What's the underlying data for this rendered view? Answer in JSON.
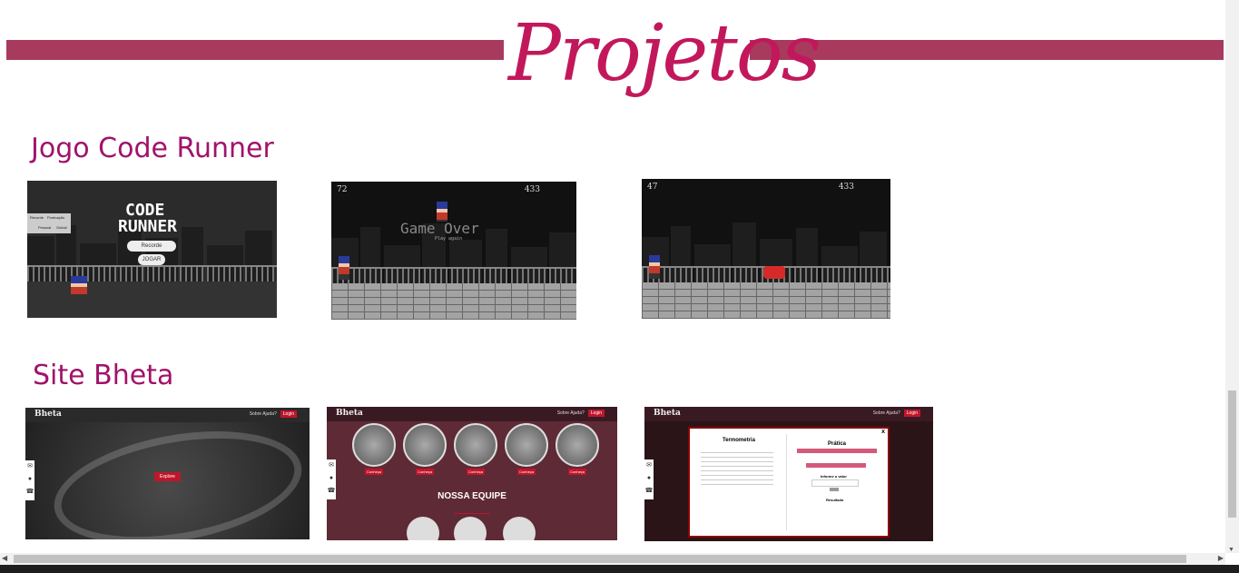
{
  "header": {
    "title": "Projetos",
    "accent_color": "#a73a5d",
    "title_color": "#c2185b"
  },
  "sections": [
    {
      "title": "Jogo Code Runner",
      "thumbs": [
        {
          "logo_line1": "CODE",
          "logo_line2": "RUNNER",
          "menu_left": "Recorde",
          "menu_right": "Pontuação",
          "tab_left": "Pessoal",
          "tab_right": "Global",
          "button1": "Recorde",
          "button2": "JOGAR"
        },
        {
          "score_left": "72",
          "score_right": "433",
          "overlay": "Game Over",
          "overlay_sub": "Play again"
        },
        {
          "score_left": "47",
          "score_right": "433"
        }
      ]
    },
    {
      "title": "Site Bheta",
      "thumbs": [
        {
          "brand": "Bheta",
          "nav_link1": "Sobre",
          "nav_link2": "Ajuda?",
          "nav_login": "Login",
          "cta": "Explore"
        },
        {
          "brand": "Bheta",
          "nav_link1": "Sobre",
          "nav_link2": "Ajuda?",
          "nav_login": "Login",
          "heading": "NOSSA EQUIPE",
          "chip": "Conheça"
        },
        {
          "brand": "Bheta",
          "nav_link1": "Sobre",
          "nav_link2": "Ajuda?",
          "nav_login": "Login",
          "modal_left_title": "Termometria",
          "modal_right_title": "Prática",
          "modal_input_label": "Informe o valor",
          "modal_result": "Resultado",
          "modal_close": "x"
        }
      ]
    }
  ]
}
